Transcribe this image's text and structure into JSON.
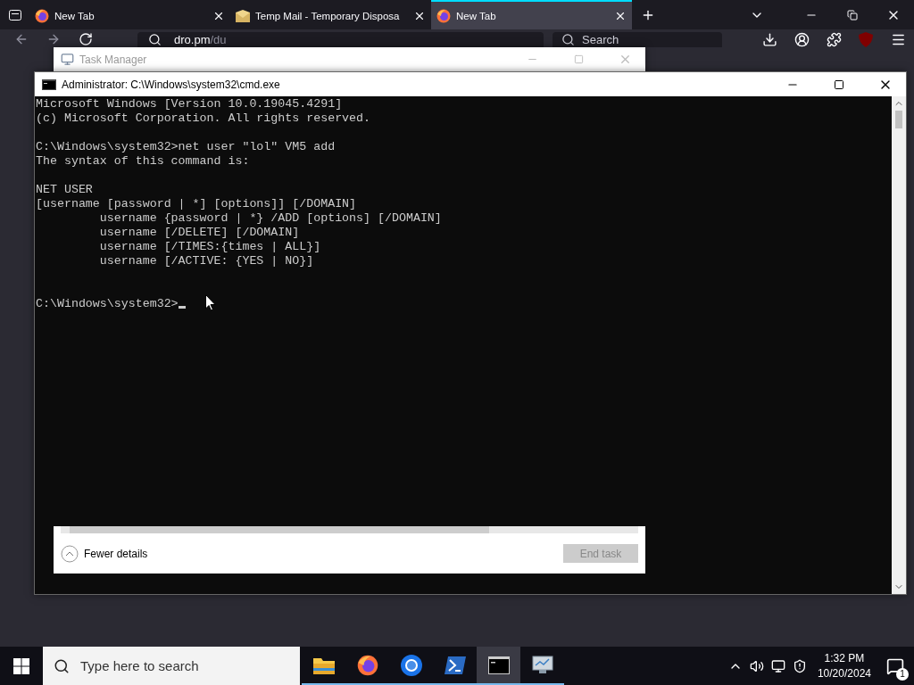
{
  "browser": {
    "tabs": [
      {
        "title": "New Tab",
        "kind": "firefox",
        "selected": false
      },
      {
        "title": "Temp Mail - Temporary Disposa",
        "kind": "mail",
        "selected": false
      },
      {
        "title": "New Tab",
        "kind": "firefox",
        "selected": true
      }
    ],
    "address": "dro.pm/du",
    "search_placeholder": "Search"
  },
  "task_manager": {
    "title": "Task Manager",
    "details_toggle": "Fewer details",
    "end_task_button": {
      "label": "End task",
      "disabled": true
    }
  },
  "console": {
    "title": "Administrator: C:\\Windows\\system32\\cmd.exe",
    "blocks": [
      [
        "Microsoft Windows [Version 10.0.19045.4291]",
        "(c) Microsoft Corporation. All rights reserved."
      ],
      [
        "C:\\Windows\\system32>net user \"lol\" VM5 add",
        "The syntax of this command is:"
      ],
      [
        "NET USER",
        "[username [password | *] [options]] [/DOMAIN]",
        "         username {password | *} /ADD [options] [/DOMAIN]",
        "         username [/DELETE] [/DOMAIN]",
        "         username [/TIMES:{times | ALL}]",
        "         username [/ACTIVE: {YES | NO}]"
      ]
    ],
    "prompt": "C:\\Windows\\system32>"
  },
  "taskbar": {
    "search_placeholder": "Type here to search",
    "apps": [
      {
        "kind": "folder",
        "selected": false
      },
      {
        "kind": "firefox",
        "selected": false
      },
      {
        "kind": "browser",
        "selected": false
      },
      {
        "kind": "powershell",
        "selected": false
      },
      {
        "kind": "cmd",
        "selected": true
      },
      {
        "kind": "monitor",
        "selected": false
      }
    ],
    "time": "1:32 PM",
    "date": "10/20/2024",
    "notification_count": "1"
  }
}
